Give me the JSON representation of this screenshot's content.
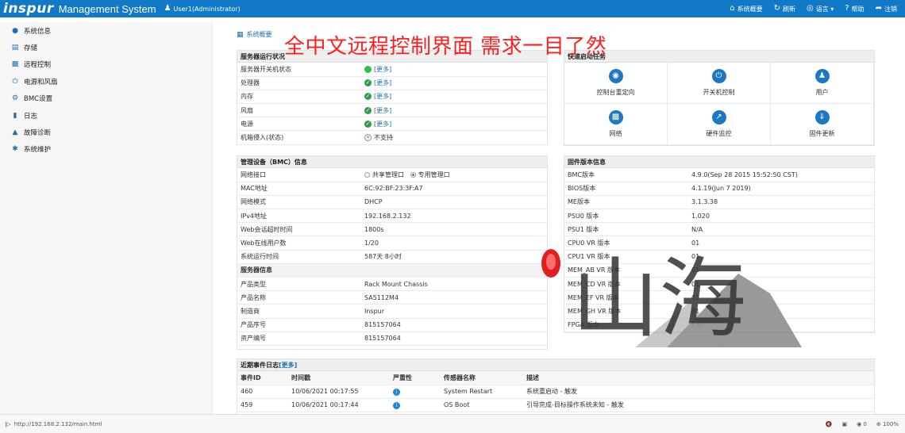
{
  "header": {
    "logo": "inspur",
    "title": "Management System",
    "user": "User1(Administrator)",
    "nav": [
      {
        "label": "系统概要",
        "icon": "home-icon"
      },
      {
        "label": "刷新",
        "icon": "refresh-icon"
      },
      {
        "label": "语言 ▾",
        "icon": "globe-icon"
      },
      {
        "label": "帮助",
        "icon": "help-icon"
      },
      {
        "label": "注销",
        "icon": "logout-icon"
      }
    ]
  },
  "sidebar": {
    "items": [
      {
        "label": "系统信息",
        "icon": "info-icon"
      },
      {
        "label": "存储",
        "icon": "storage-icon"
      },
      {
        "label": "远程控制",
        "icon": "monitor-icon"
      },
      {
        "label": "电源和风扇",
        "icon": "power-icon"
      },
      {
        "label": "BMC设置",
        "icon": "gear-icon"
      },
      {
        "label": "日志",
        "icon": "chat-icon"
      },
      {
        "label": "故障诊断",
        "icon": "warning-icon"
      },
      {
        "label": "系统维护",
        "icon": "maintenance-icon"
      }
    ]
  },
  "main": {
    "breadcrumb": "系统概要",
    "annotation": "全中文远程控制界面 需求一目了然",
    "server_status": {
      "title": "服务器运行状况",
      "more": "[更多]",
      "rows": [
        {
          "key": "服务器开关机状态",
          "status": "green",
          "value": "[更多]"
        },
        {
          "key": "处理器",
          "status": "check",
          "value": "[更多]"
        },
        {
          "key": "内存",
          "status": "check",
          "value": "[更多]"
        },
        {
          "key": "风扇",
          "status": "check",
          "value": "[更多]"
        },
        {
          "key": "电源",
          "status": "check",
          "value": "[更多]"
        },
        {
          "key": "机箱侵入(状态)",
          "status": "gray",
          "value": "不支持"
        }
      ]
    },
    "quick_tasks": {
      "title": "快速启动任务",
      "items": [
        {
          "label": "控制台重定向",
          "icon": "broadcast-icon"
        },
        {
          "label": "开关机控制",
          "icon": "power-icon"
        },
        {
          "label": "用户",
          "icon": "user-icon"
        },
        {
          "label": "网络",
          "icon": "monitor-icon"
        },
        {
          "label": "硬件监控",
          "icon": "chart-icon"
        },
        {
          "label": "固件更新",
          "icon": "download-icon"
        }
      ]
    },
    "bmc": {
      "title": "管理设备（BMC）信息",
      "network_port_label": "网络接口",
      "network_port_options": [
        "共享管理口",
        "专用管理口"
      ],
      "rows": [
        {
          "key": "MAC地址",
          "value": "6C:92:BF:23:3F:A7"
        },
        {
          "key": "网络模式",
          "value": "DHCP"
        },
        {
          "key": "IPv4地址",
          "value": "192.168.2.132"
        },
        {
          "key": "Web会话超时时间",
          "value": "1800s"
        },
        {
          "key": "Web在线用户数",
          "value": "1/20"
        },
        {
          "key": "系统运行时间",
          "value": "587天 8小时"
        }
      ],
      "server_info_title": "服务器信息",
      "server_rows": [
        {
          "key": "产品类型",
          "value": "Rack Mount Chassis"
        },
        {
          "key": "产品名称",
          "value": "SA5112M4"
        },
        {
          "key": "制造商",
          "value": "Inspur"
        },
        {
          "key": "产品序号",
          "value": "815157064"
        },
        {
          "key": "资产编号",
          "value": "815157064"
        }
      ]
    },
    "firmware": {
      "title": "固件版本信息",
      "rows": [
        {
          "key": "BMC版本",
          "value": "4.9.0(Sep 28 2015 15:52:50 CST)"
        },
        {
          "key": "BIOS版本",
          "value": "4.1.19(Jun 7 2019)"
        },
        {
          "key": "ME版本",
          "value": "3.1.3.38"
        },
        {
          "key": "PSU0 版本",
          "value": "1.020"
        },
        {
          "key": "PSU1 版本",
          "value": "N/A"
        },
        {
          "key": "CPU0 VR 版本",
          "value": "01"
        },
        {
          "key": "CPU1 VR 版本",
          "value": "01"
        },
        {
          "key": "MEM_AB VR 版本",
          "value": "01"
        },
        {
          "key": "MEM_CD VR 版本",
          "value": "01"
        },
        {
          "key": "MEM_EF VR 版本",
          "value": "01"
        },
        {
          "key": "MEM_GH VR 版本",
          "value": "01"
        },
        {
          "key": "FPGA 版本",
          "value": "1.0"
        }
      ]
    },
    "events": {
      "title": "近期事件日志",
      "more": "[更多]",
      "columns": [
        "事件ID",
        "时间戳",
        "严重性",
        "传感器名称",
        "描述"
      ],
      "rows": [
        {
          "id": "460",
          "time": "10/06/2021 00:17:55",
          "sensor": "System Restart",
          "desc": "系统重启动 - 触发"
        },
        {
          "id": "459",
          "time": "10/06/2021 00:17:44",
          "sensor": "OS Boot",
          "desc": "引导完成-目标操作系统未知 - 触发"
        }
      ]
    },
    "watermark_text": "山海"
  },
  "statusbar": {
    "url": "http://192.168.2.132/main.html",
    "zoom": "100%",
    "downloads": "0"
  }
}
